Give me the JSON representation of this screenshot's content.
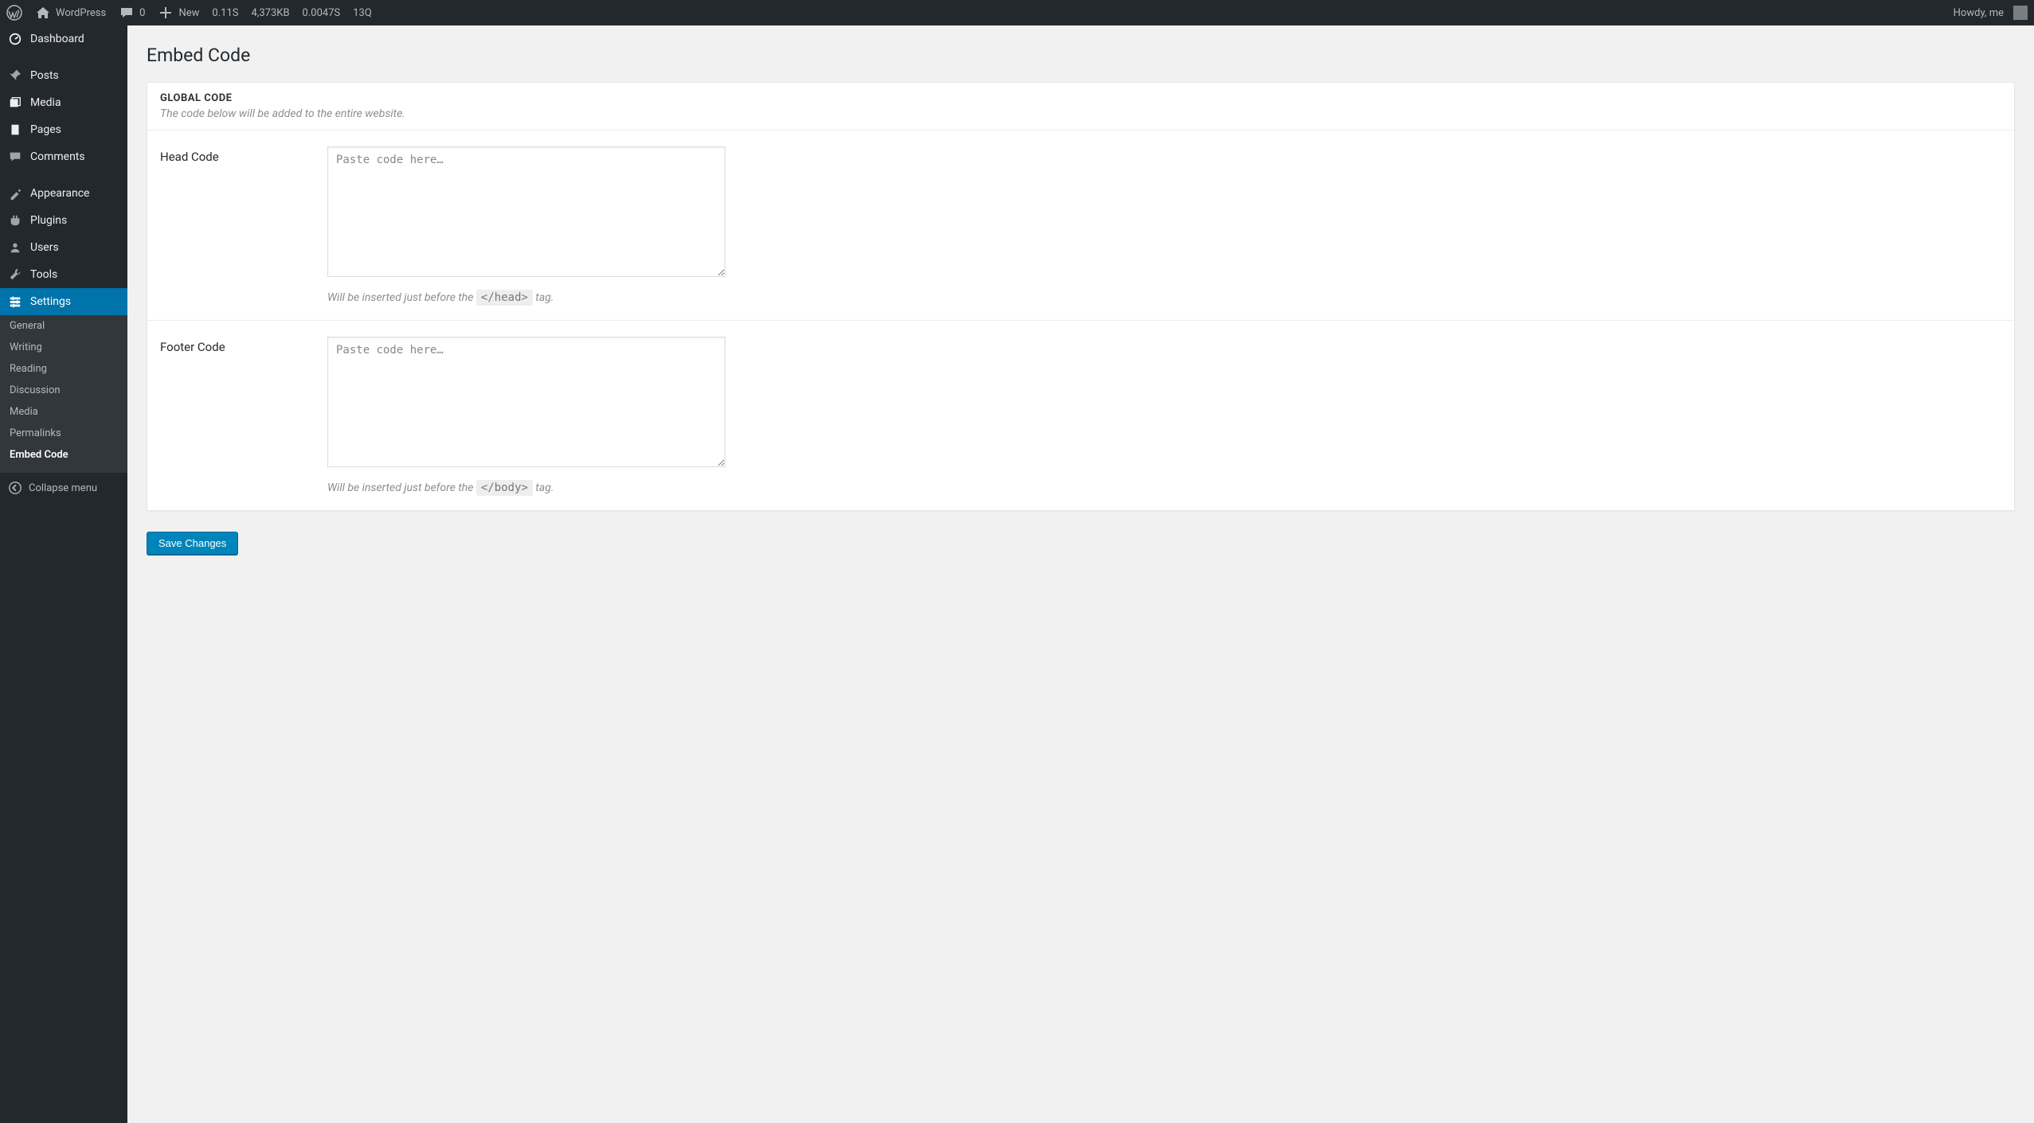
{
  "topbar": {
    "site_name": "WordPress",
    "comments_count": "0",
    "new_label": "New",
    "stat_time": "0.11S",
    "stat_memory": "4,373KB",
    "stat_db": "0.0047S",
    "stat_queries": "13Q",
    "howdy": "Howdy, me"
  },
  "sidebar": {
    "items": [
      {
        "label": "Dashboard"
      },
      {
        "label": "Posts"
      },
      {
        "label": "Media"
      },
      {
        "label": "Pages"
      },
      {
        "label": "Comments"
      },
      {
        "label": "Appearance"
      },
      {
        "label": "Plugins"
      },
      {
        "label": "Users"
      },
      {
        "label": "Tools"
      },
      {
        "label": "Settings",
        "current": true
      }
    ],
    "submenu": [
      {
        "label": "General"
      },
      {
        "label": "Writing"
      },
      {
        "label": "Reading"
      },
      {
        "label": "Discussion"
      },
      {
        "label": "Media"
      },
      {
        "label": "Permalinks"
      },
      {
        "label": "Embed Code",
        "current": true
      }
    ],
    "collapse_label": "Collapse menu"
  },
  "page": {
    "title": "Embed Code",
    "panel_heading": "GLOBAL CODE",
    "panel_subheading": "The code below will be added to the entire website.",
    "head_code_label": "Head Code",
    "head_code_placeholder": "Paste code here…",
    "head_hint_prefix": "Will be inserted just before the ",
    "head_hint_tag": "</head>",
    "head_hint_suffix": " tag.",
    "footer_code_label": "Footer Code",
    "footer_code_placeholder": "Paste code here…",
    "footer_hint_prefix": "Will be inserted just before the ",
    "footer_hint_tag": "</body>",
    "footer_hint_suffix": " tag.",
    "save_label": "Save Changes"
  }
}
